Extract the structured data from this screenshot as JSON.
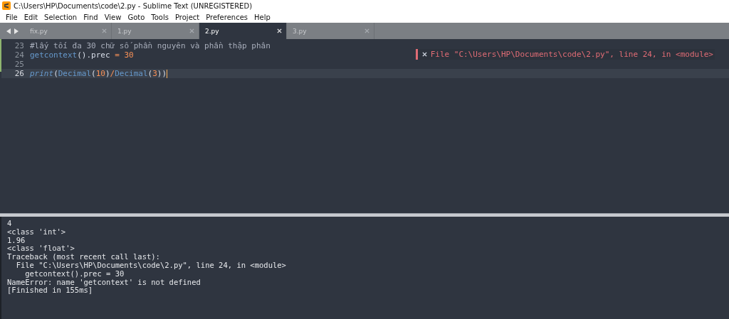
{
  "window": {
    "title": "C:\\Users\\HP\\Documents\\code\\2.py - Sublime Text (UNREGISTERED)"
  },
  "menu": [
    "File",
    "Edit",
    "Selection",
    "Find",
    "View",
    "Goto",
    "Tools",
    "Project",
    "Preferences",
    "Help"
  ],
  "tabs": [
    {
      "label": "fix.py",
      "selected": false
    },
    {
      "label": "1.py",
      "selected": false
    },
    {
      "label": "2.py",
      "selected": true
    },
    {
      "label": "3.py",
      "selected": false
    }
  ],
  "editor": {
    "lines": [
      {
        "number": "23",
        "current": false,
        "tokens": [
          {
            "kind": "comment",
            "text": "#lấy tối đa 30 chữ số phần nguyên và phần thập phân"
          }
        ]
      },
      {
        "number": "24",
        "current": false,
        "tokens": [
          {
            "kind": "call",
            "text": "getcontext"
          },
          {
            "kind": "plain",
            "text": "().prec "
          },
          {
            "kind": "operator",
            "text": "= "
          },
          {
            "kind": "number",
            "text": "30"
          }
        ]
      },
      {
        "number": "25",
        "current": false
      },
      {
        "number": "26",
        "current": true,
        "tokens": [
          {
            "kind": "builtin",
            "text": "print"
          },
          {
            "kind": "plain",
            "text": "("
          },
          {
            "kind": "call",
            "text": "Decimal"
          },
          {
            "kind": "plain",
            "text": "("
          },
          {
            "kind": "number",
            "text": "10"
          },
          {
            "kind": "plain",
            "text": ")"
          },
          {
            "kind": "operator",
            "text": "/"
          },
          {
            "kind": "call",
            "text": "Decimal"
          },
          {
            "kind": "plain",
            "text": "("
          },
          {
            "kind": "number",
            "text": "3"
          },
          {
            "kind": "plain",
            "text": "))"
          }
        ]
      }
    ],
    "error_annotation": "File \"C:\\Users\\HP\\Documents\\code\\2.py\", line 24, in <module>"
  },
  "output": [
    "4",
    "<class 'int'>",
    "1.96",
    "<class 'float'>",
    "Traceback (most recent call last):",
    "  File \"C:\\Users\\HP\\Documents\\code\\2.py\", line 24, in <module>",
    "    getcontext().prec = 30",
    "NameError: name 'getcontext' is not defined",
    "[Finished in 155ms]"
  ]
}
